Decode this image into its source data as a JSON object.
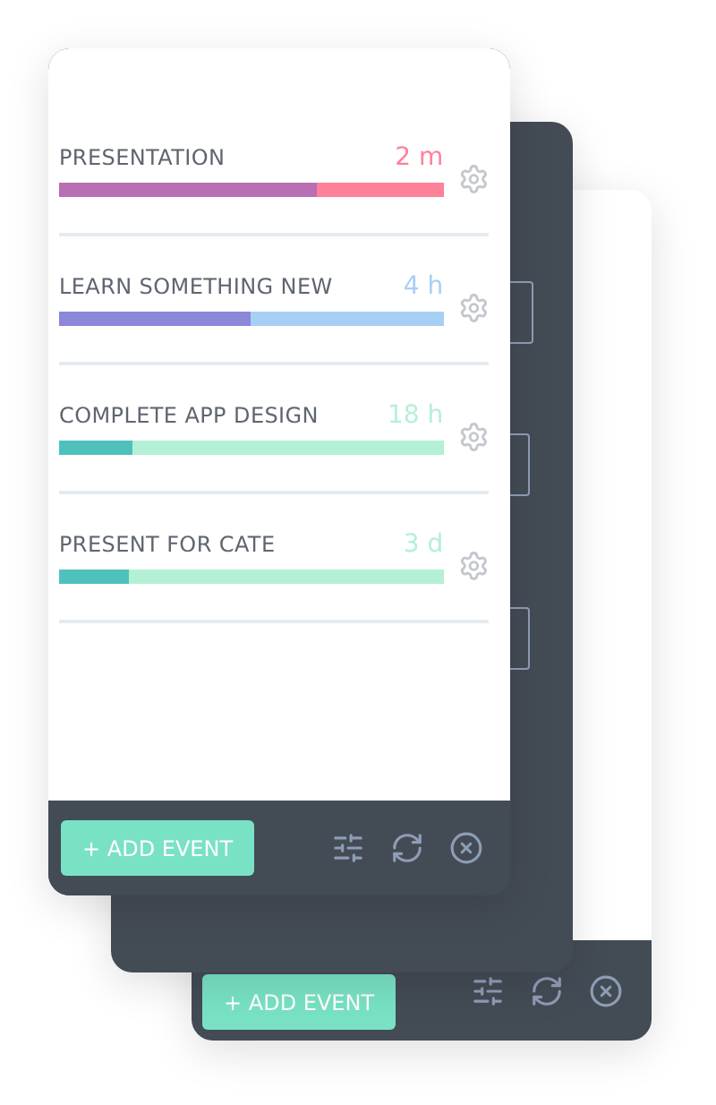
{
  "front_card": {
    "events": [
      {
        "name": "PRESENTATION",
        "remaining": "2 m",
        "color": "#ff8099",
        "progress": {
          "level": 0.67,
          "color": "#b86fb4"
        }
      },
      {
        "name": "LEARN SOMETHING NEW",
        "remaining": "4 h",
        "color": "#a7cff5",
        "progress": {
          "level": 0.5,
          "color": "#8b87d9"
        }
      },
      {
        "name": "COMPLETE APP DESIGN",
        "remaining": "18 h",
        "color": "#b4f0d5",
        "progress": {
          "level": 0.19,
          "color": "#4fc1bd"
        }
      },
      {
        "name": "PRESENT FOR CATE",
        "remaining": "3 d",
        "color": "#b4f0d5",
        "progress": {
          "level": 0.18,
          "color": "#4fc1bd"
        }
      }
    ],
    "add_button": "+ ADD EVENT"
  },
  "back_card": {
    "add_button": "+ ADD EVENT"
  }
}
